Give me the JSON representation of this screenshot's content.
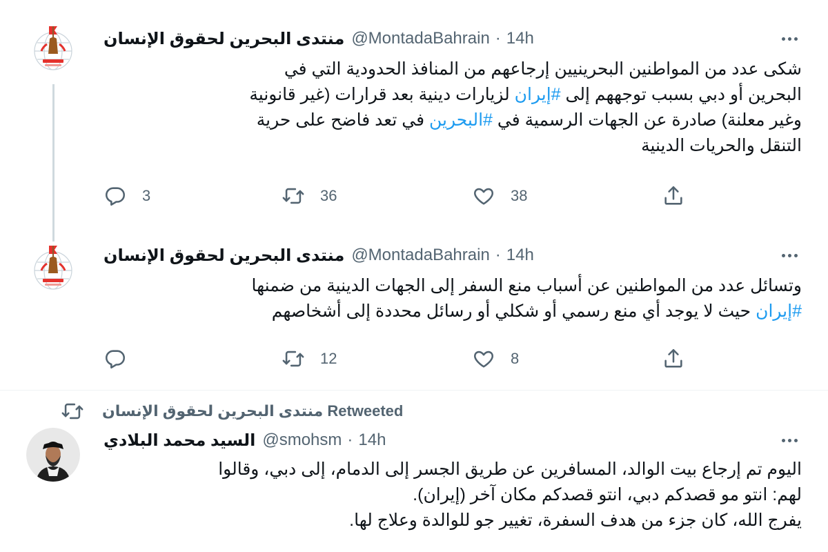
{
  "tweets": [
    {
      "display_name": "منتدى البحرين لحقوق الإنسان",
      "handle": "@MontadaBahrain",
      "separator": "·",
      "time": "14h",
      "text_lines": [
        [
          {
            "t": "شكى عدد من المواطنين البحرينيين إرجاعهم من المنافذ الحدودية التي في"
          }
        ],
        [
          {
            "t": "البحرين أو دبي بسبب توجههم إلى "
          },
          {
            "t": "#إيران",
            "tag": true
          },
          {
            "t": " لزيارات دينية بعد قرارات (غير قانونية"
          }
        ],
        [
          {
            "t": "وغير معلنة) صادرة عن الجهات الرسمية في "
          },
          {
            "t": "#البحرين",
            "tag": true
          },
          {
            "t": " في تعد فاضح على حرية"
          }
        ],
        [
          {
            "t": "التنقل والحريات الدينية"
          }
        ]
      ],
      "replies": "3",
      "retweets": "36",
      "likes": "38"
    },
    {
      "display_name": "منتدى البحرين لحقوق الإنسان",
      "handle": "@MontadaBahrain",
      "separator": "·",
      "time": "14h",
      "text_lines": [
        [
          {
            "t": "وتسائل عدد من المواطنين عن أسباب منع السفر إلى الجهات الدينية من ضمنها"
          }
        ],
        [
          {
            "t": "#إيران",
            "tag": true
          },
          {
            "t": " حيث لا يوجد أي منع رسمي أو شكلي أو رسائل محددة إلى أشخاصهم"
          }
        ]
      ],
      "replies": "",
      "retweets": "12",
      "likes": "8"
    },
    {
      "retweet_context": "منتدى البحرين لحقوق الإنسان Retweeted",
      "display_name": "السيد محمد البلادي",
      "handle": "@smohsm",
      "separator": "·",
      "time": "14h",
      "text_lines": [
        [
          {
            "t": "اليوم تم إرجاع بيت الوالد، المسافرين عن طريق الجسر إلى الدمام، إلى دبي، وقالوا"
          }
        ],
        [
          {
            "t": "لهم: انتو مو قصدكم دبي، انتو قصدكم مكان آخر (إيران)."
          }
        ],
        [
          {
            "t": "يفرج الله، كان جزء من هدف السفرة، تغيير جو للوالدة وعلاج لها."
          }
        ]
      ]
    }
  ],
  "icons": {
    "more": "more-horizontal-icon",
    "reply": "reply-icon",
    "retweet": "retweet-icon",
    "like": "heart-icon",
    "share": "share-icon"
  },
  "colors": {
    "hashtag": "#1d9bf0",
    "secondary_text": "#536471",
    "thread_line": "#cfd9de"
  }
}
